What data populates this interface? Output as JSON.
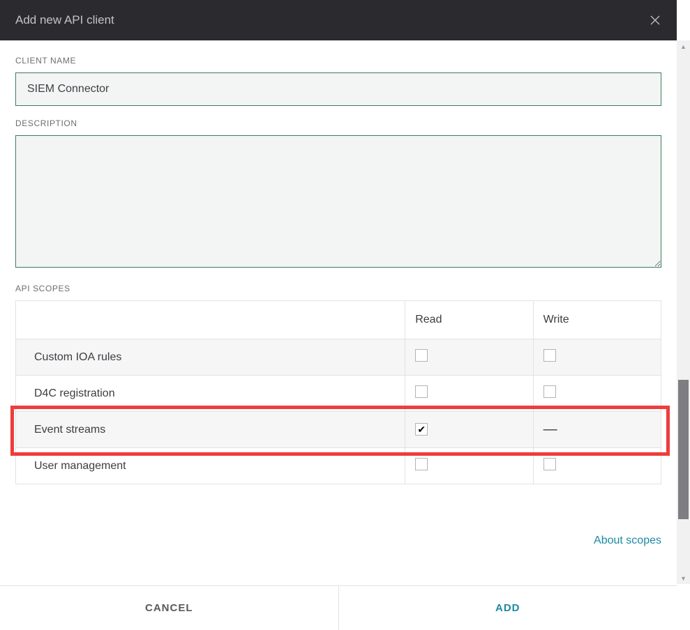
{
  "header": {
    "title": "Add new API client"
  },
  "form": {
    "client_name_label": "CLIENT NAME",
    "client_name_value": "SIEM Connector",
    "description_label": "DESCRIPTION",
    "description_value": "",
    "api_scopes_label": "API SCOPES"
  },
  "table": {
    "columns": {
      "name": "",
      "read": "Read",
      "write": "Write"
    },
    "rows": [
      {
        "name": "Custom IOA rules",
        "read": false,
        "write": false,
        "write_na": false,
        "alt": true
      },
      {
        "name": "D4C registration",
        "read": false,
        "write": false,
        "write_na": false,
        "alt": false
      },
      {
        "name": "Event streams",
        "read": true,
        "write": false,
        "write_na": true,
        "alt": true,
        "highlight": true
      },
      {
        "name": "User management",
        "read": false,
        "write": false,
        "write_na": false,
        "alt": false
      }
    ]
  },
  "links": {
    "about_scopes": "About scopes"
  },
  "footer": {
    "cancel": "CANCEL",
    "add": "ADD"
  },
  "write_na_symbol": "—"
}
